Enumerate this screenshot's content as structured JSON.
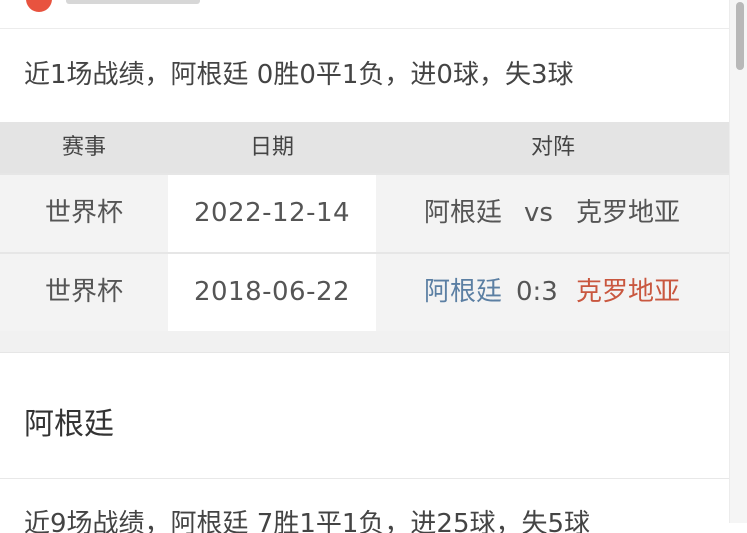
{
  "summary": {
    "text": "近1场战绩，阿根廷 0胜0平1负，进0球，失3球"
  },
  "table": {
    "headers": [
      "赛事",
      "日期",
      "对阵"
    ],
    "rows": [
      {
        "event": "世界杯",
        "date": "2022-12-14",
        "home": "阿根廷",
        "mid": "vs",
        "away": "克罗地亚"
      },
      {
        "event": "世界杯",
        "date": "2018-06-22",
        "home": "阿根廷",
        "mid": "0:3",
        "away": "克罗地亚"
      }
    ]
  },
  "team_section": {
    "title": "阿根廷"
  },
  "summary2": {
    "text": "近9场战绩，阿根廷 7胜1平1负，进25球，失5球"
  },
  "colors": {
    "home_team": "#5b7fa3",
    "away_team": "#c9573f",
    "header_bg": "#e4e4e4",
    "row_bg": "#f3f3f3"
  }
}
